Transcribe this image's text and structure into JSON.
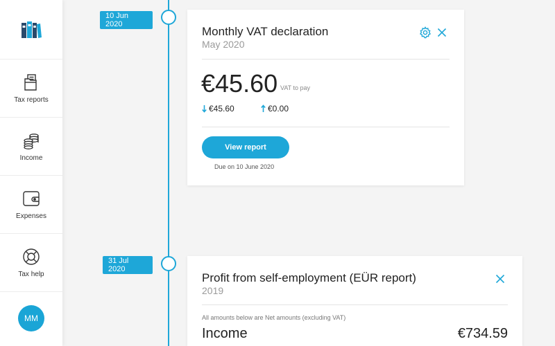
{
  "sidebar": {
    "logo_icon": "binders-icon",
    "items": [
      {
        "label": "Tax reports",
        "icon": "folder-docs-icon"
      },
      {
        "label": "Income",
        "icon": "coins-icon"
      },
      {
        "label": "Expenses",
        "icon": "wallet-icon"
      },
      {
        "label": "Tax help",
        "icon": "lifebuoy-icon"
      }
    ],
    "avatar_initials": "MM"
  },
  "timeline": {
    "accent": "#1ea7d8",
    "events": [
      {
        "date": "10 Jun 2020",
        "card": {
          "title": "Monthly VAT declaration",
          "subtitle": "May 2020",
          "amount": "€45.60",
          "amount_note": "VAT to pay",
          "down_value": "€45.60",
          "up_value": "€0.00",
          "button_label": "View report",
          "due_text": "Due on 10 June 2020"
        }
      },
      {
        "date": "31 Jul 2020",
        "card": {
          "title": "Profit from self-employment (EÜR report)",
          "subtitle": "2019",
          "note": "All amounts below are Net amounts (excluding VAT)",
          "row_label": "Income",
          "row_value": "€734.59"
        }
      }
    ]
  }
}
